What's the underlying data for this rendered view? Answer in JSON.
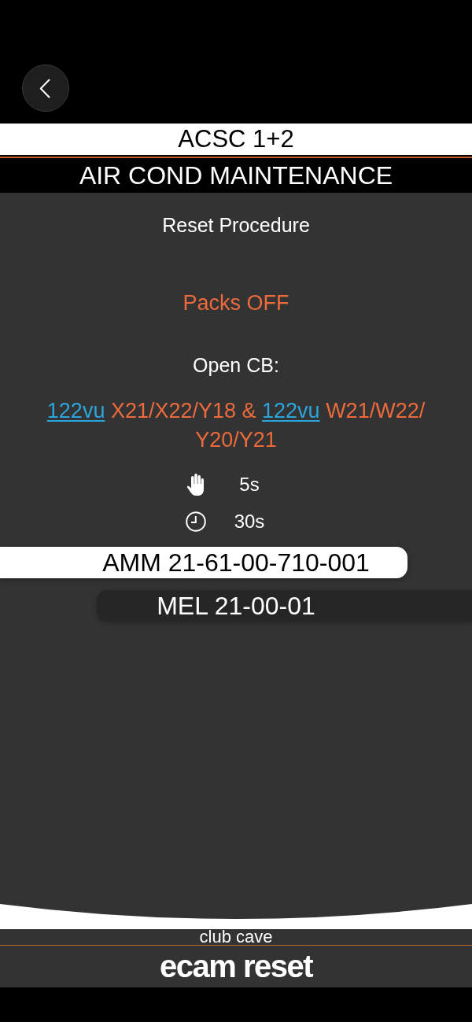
{
  "header": {
    "subtitle": "ACSC 1+2",
    "title": "AIR COND MAINTENANCE"
  },
  "procedure": {
    "heading": "Reset Procedure",
    "action": "Packs OFF",
    "instruction": "Open CB:",
    "breakers": [
      {
        "kind": "link",
        "text": "122vu"
      },
      {
        "kind": "text",
        "text": " X21/X22/Y18 & "
      },
      {
        "kind": "link",
        "text": "122vu"
      },
      {
        "kind": "text",
        "text": " W21/W22/"
      },
      {
        "kind": "text",
        "text": "Y20/Y21"
      }
    ],
    "timers": [
      {
        "kind": "hand",
        "value": "5s"
      },
      {
        "kind": "clock",
        "value": "30s"
      }
    ]
  },
  "references": [
    {
      "label": "AMM 21-61-00-710-001",
      "selected": true
    },
    {
      "label": "MEL 21-00-01",
      "selected": false
    }
  ],
  "footer": {
    "caption": "club cave",
    "brand": "ecam reset"
  }
}
